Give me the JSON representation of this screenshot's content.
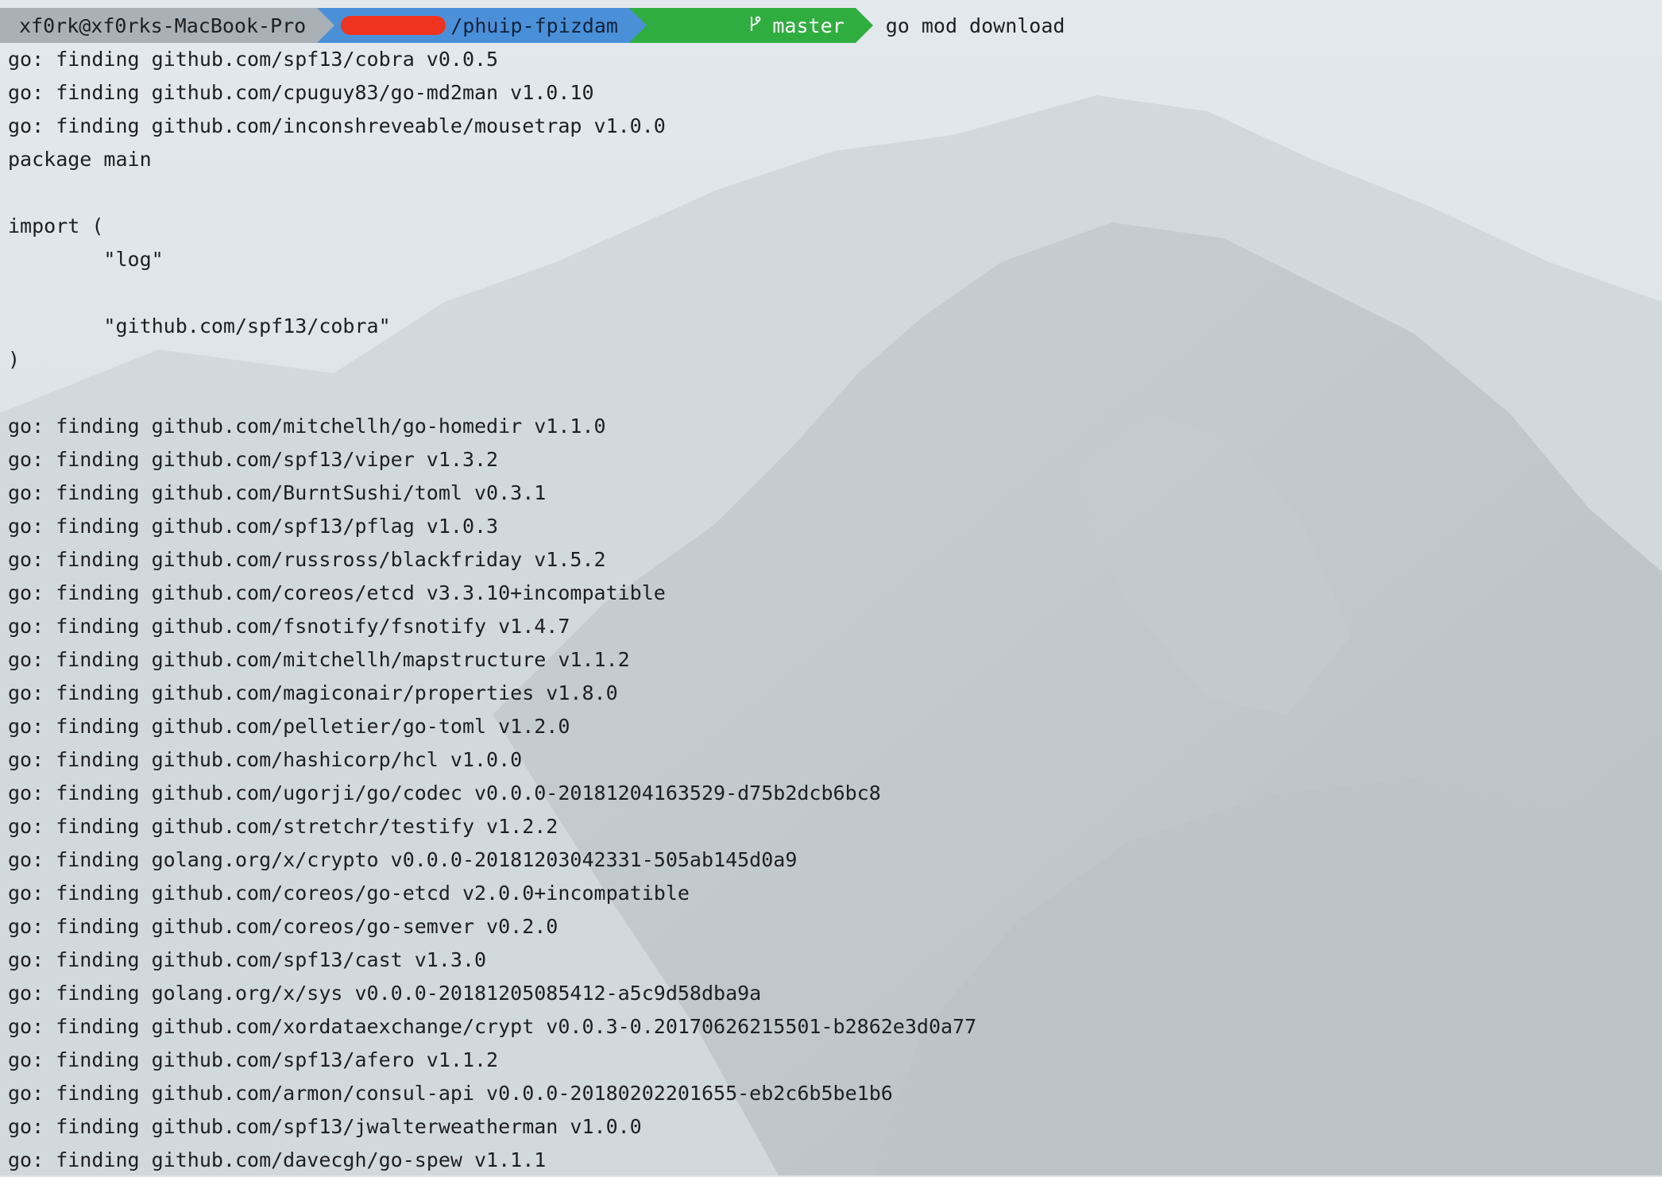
{
  "prompt": {
    "user_host": "xf0rk@xf0rks-MacBook-Pro",
    "directory": "/phuip-fpizdam",
    "branch_icon": "git-branch-icon",
    "branch": "master",
    "command": "go mod download"
  },
  "colors": {
    "user_segment": "#a9b0b6",
    "dir_segment": "#4a90d9",
    "git_segment": "#2fae3f",
    "redaction": "#f0331e",
    "text": "#1d1f21"
  },
  "output_lines": [
    "go: finding github.com/spf13/cobra v0.0.5",
    "go: finding github.com/cpuguy83/go-md2man v1.0.10",
    "go: finding github.com/inconshreveable/mousetrap v1.0.0",
    "package main",
    "",
    "import (",
    "        \"log\"",
    "",
    "        \"github.com/spf13/cobra\"",
    ")",
    "",
    "go: finding github.com/mitchellh/go-homedir v1.1.0",
    "go: finding github.com/spf13/viper v1.3.2",
    "go: finding github.com/BurntSushi/toml v0.3.1",
    "go: finding github.com/spf13/pflag v1.0.3",
    "go: finding github.com/russross/blackfriday v1.5.2",
    "go: finding github.com/coreos/etcd v3.3.10+incompatible",
    "go: finding github.com/fsnotify/fsnotify v1.4.7",
    "go: finding github.com/mitchellh/mapstructure v1.1.2",
    "go: finding github.com/magiconair/properties v1.8.0",
    "go: finding github.com/pelletier/go-toml v1.2.0",
    "go: finding github.com/hashicorp/hcl v1.0.0",
    "go: finding github.com/ugorji/go/codec v0.0.0-20181204163529-d75b2dcb6bc8",
    "go: finding github.com/stretchr/testify v1.2.2",
    "go: finding golang.org/x/crypto v0.0.0-20181203042331-505ab145d0a9",
    "go: finding github.com/coreos/go-etcd v2.0.0+incompatible",
    "go: finding github.com/coreos/go-semver v0.2.0",
    "go: finding github.com/spf13/cast v1.3.0",
    "go: finding golang.org/x/sys v0.0.0-20181205085412-a5c9d58dba9a",
    "go: finding github.com/xordataexchange/crypt v0.0.3-0.20170626215501-b2862e3d0a77",
    "go: finding github.com/spf13/afero v1.1.2",
    "go: finding github.com/armon/consul-api v0.0.0-20180202201655-eb2c6b5be1b6",
    "go: finding github.com/spf13/jwalterweatherman v1.0.0",
    "go: finding github.com/davecgh/go-spew v1.1.1"
  ]
}
